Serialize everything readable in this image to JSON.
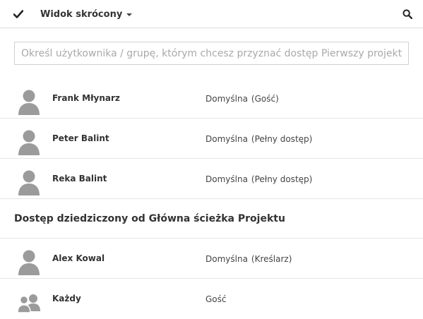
{
  "toolbar": {
    "check_icon": "checkmark-icon",
    "view_label": "Widok skrócony",
    "search_icon": "search-icon"
  },
  "search": {
    "placeholder": "Określ użytkownika / grupę, którym chcesz przyznać dostęp Pierwszy projekt"
  },
  "direct_access": [
    {
      "name": "Frank Młynarz",
      "role": "Domyślna",
      "access": "(Gość)",
      "icon": "user-icon"
    },
    {
      "name": "Peter Balint",
      "role": "Domyślna",
      "access": "(Pełny dostęp)",
      "icon": "user-icon"
    },
    {
      "name": "Reka Balint",
      "role": "Domyślna",
      "access": "(Pełny dostęp)",
      "icon": "user-icon"
    }
  ],
  "inherited": {
    "heading": "Dostęp dziedziczony od Główna ścieżka Projektu",
    "items": [
      {
        "name": "Alex Kowal",
        "role": "Domyślna",
        "access": "(Kreślarz)",
        "icon": "user-icon"
      },
      {
        "name": "Każdy",
        "role": "Gość",
        "access": "",
        "icon": "group-icon"
      }
    ]
  }
}
